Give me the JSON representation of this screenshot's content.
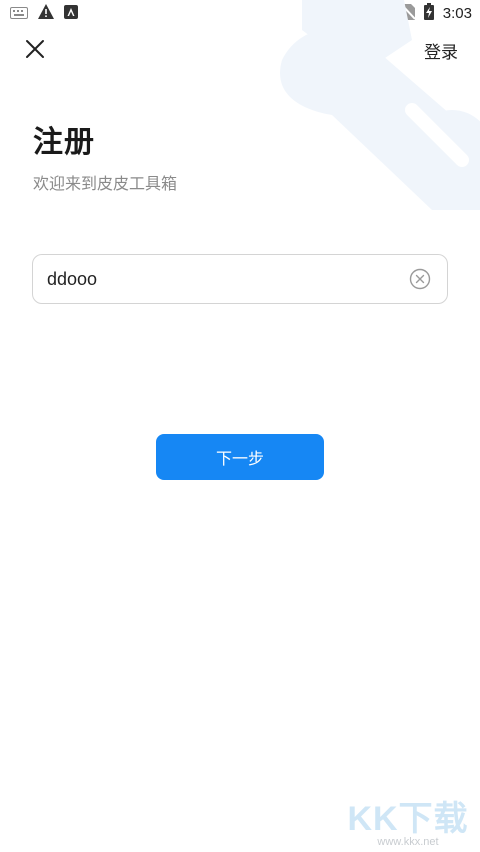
{
  "status_bar": {
    "time": "3:03",
    "icons": [
      "keyboard-icon",
      "warning-icon",
      "app-notification-icon",
      "wifi-icon",
      "no-sim-icon",
      "battery-charging-icon"
    ]
  },
  "header": {
    "close_icon": "close-icon",
    "login_label": "登录"
  },
  "page": {
    "title": "注册",
    "subtitle": "欢迎来到皮皮工具箱"
  },
  "form": {
    "username_value": "ddooo",
    "clear_icon": "clear-circle-icon"
  },
  "actions": {
    "next_label": "下一步"
  },
  "watermark": {
    "logo_text": "KK下载",
    "url": "www.kkx.net"
  },
  "colors": {
    "accent": "#1687f4",
    "decoration": "#f0f5fb",
    "watermark": "#cfe6f6"
  }
}
